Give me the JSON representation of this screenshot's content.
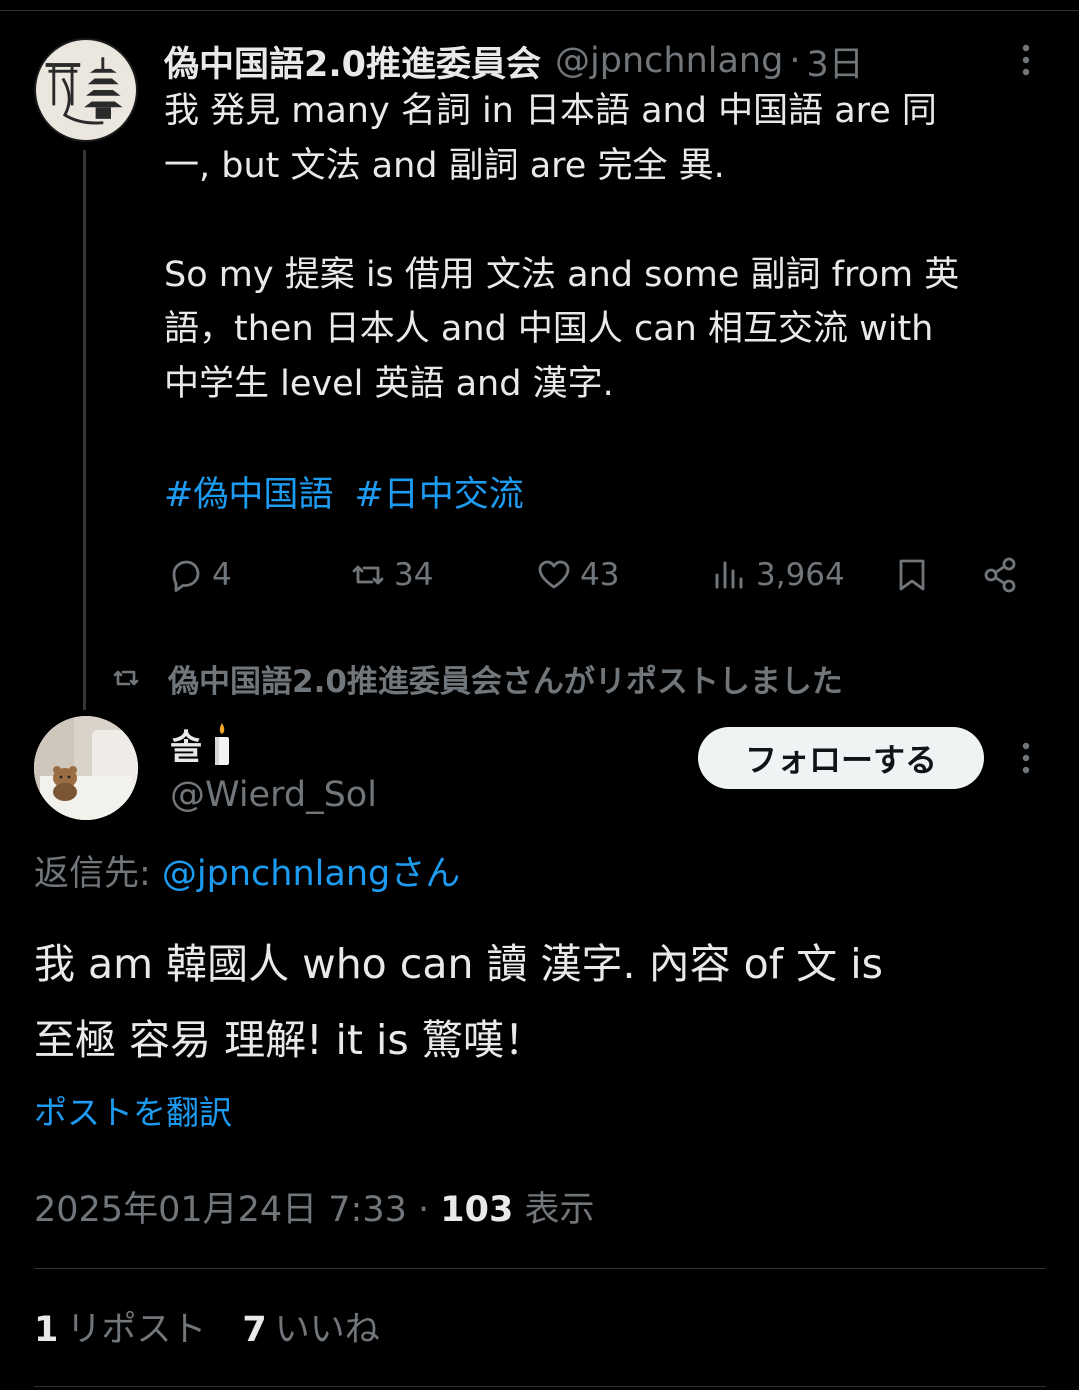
{
  "parent_tweet": {
    "author_name": "偽中国語2.0推進委員会",
    "author_handle": "@jpnchnlang",
    "time": "3日",
    "separator": "·",
    "body_lines": [
      "我 発見 many 名詞 in 日本語 and 中国語 are 同",
      "一, but 文法  and 副詞 are  完全 異."
    ],
    "body_lines_2": [
      "So my 提案 is 借用 文法 and some 副詞 from 英",
      "語，then 日本人 and 中国人 can 相互交流 with",
      "中学生 level 英語 and 漢字."
    ],
    "hashtags": [
      "#偽中国語",
      "#日中交流"
    ],
    "actions": {
      "replies": "4",
      "reposts": "34",
      "likes": "43",
      "views": "3,964"
    }
  },
  "repost_banner": "偽中国語2.0推進委員会さんがリポストしました",
  "main_tweet": {
    "author_name": "솔",
    "author_handle": "@Wierd_Sol",
    "follow_label": "フォローする",
    "reply_prefix": "返信先: ",
    "reply_mention": "@jpnchnlangさん",
    "body_lines": [
      "我 am 韓國人 who can 讀 漢字. 內容 of 文 is",
      "至極 容易 理解! it is 驚嘆！"
    ],
    "translate_label": "ポストを翻訳",
    "timestamp": "2025年01月24日 7:33 · ",
    "views_count": "103",
    "views_label": " 表示",
    "repost_count": "1",
    "repost_label": "リポスト",
    "like_count": "7",
    "like_label": "いいね"
  },
  "colors": {
    "background": "#000000",
    "text": "#e7e9ea",
    "muted": "#71767b",
    "link": "#1d9bf0",
    "divider": "#2f3336"
  },
  "icons": [
    "pagoda-torii-avatar",
    "more-icon",
    "reply-icon",
    "repost-icon",
    "like-icon",
    "views-icon",
    "bookmark-icon",
    "share-icon",
    "candle-emoji",
    "teddy-bear-avatar"
  ]
}
